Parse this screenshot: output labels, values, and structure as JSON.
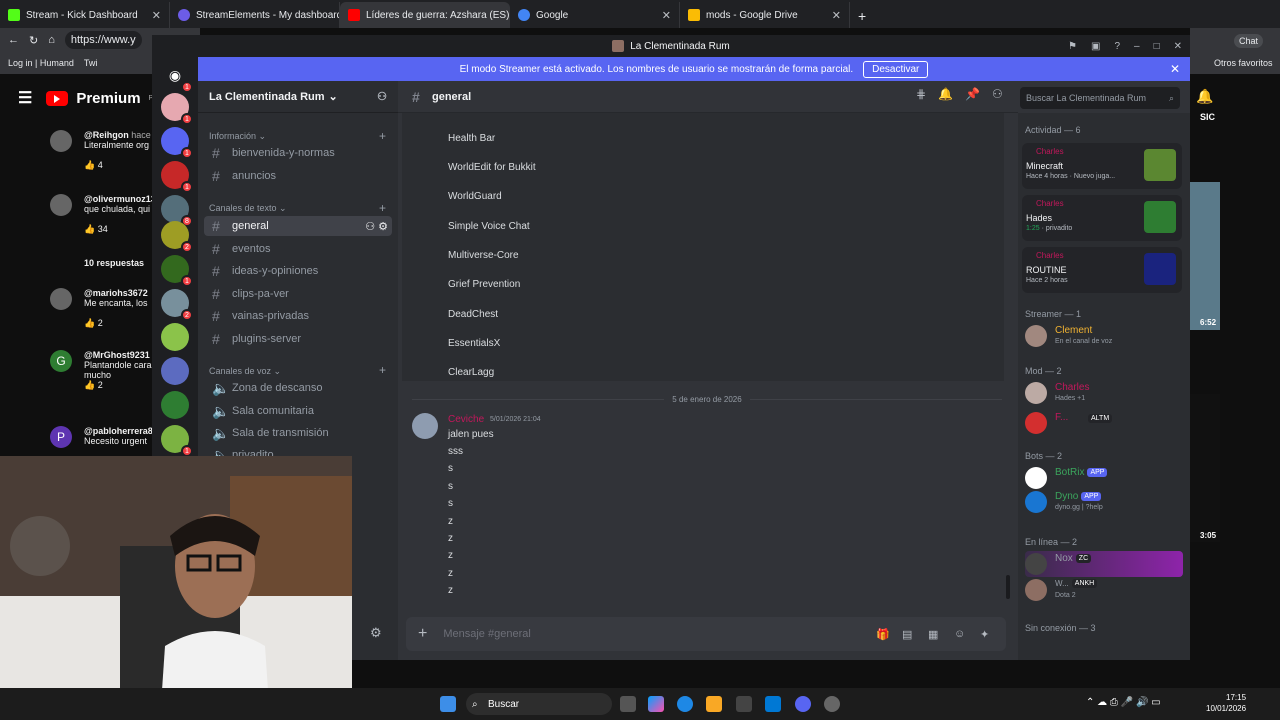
{
  "browser": {
    "tabs": [
      {
        "title": "Stream - Kick Dashboard",
        "color": "#53fc18"
      },
      {
        "title": "StreamElements - My dashboard",
        "color": "#6c5ce7"
      },
      {
        "title": "Líderes de guerra: Azshara (ES) - V",
        "color": "#ff0000"
      },
      {
        "title": "Google",
        "color": "#4285f4"
      },
      {
        "title": "mods - Google Drive",
        "color": "#fbbc04"
      }
    ],
    "url": "https://www.y",
    "bookmarks": [
      "Log in | Humand",
      "Twi"
    ],
    "other_bookmarks": "Otros favoritos",
    "chat_label": "Chat"
  },
  "youtube": {
    "logo": "Premium",
    "region": "PE",
    "comments": [
      {
        "user": "@Reihgon",
        "time": "hace 7",
        "text": "Literalmente org",
        "likes": "4"
      },
      {
        "user": "@olivermunoz13",
        "time": "",
        "text": "que chulada, qui",
        "likes": "34"
      },
      {
        "user": "@mariohs3672",
        "time": "h",
        "text": "Me encanta, los",
        "likes": "2"
      },
      {
        "user": "@MrGhost9231",
        "time": "h",
        "text": "Plantandole cara gustado mucho",
        "likes": "2"
      },
      {
        "user": "@pabloherrera86",
        "time": "",
        "text": "Necesito urgent",
        "likes": ""
      }
    ],
    "replies": "10 respuestas",
    "video_times": [
      "6:52",
      "3:05"
    ],
    "side_text": "SIC"
  },
  "discord": {
    "window_title": "La Clementinada Rum",
    "banner_text": "El modo Streamer está activado. Los nombres de usuario se mostrarán de forma parcial.",
    "banner_button": "Desactivar",
    "server_name": "La Clementinada Rum",
    "server_badges": [
      "1",
      "1",
      "1",
      "1",
      "8",
      "2",
      "1",
      "2",
      "1"
    ],
    "categories": {
      "info": "Información",
      "text": "Canales de texto",
      "voice": "Canales de voz"
    },
    "info_channels": [
      "bienvenida-y-normas",
      "anuncios"
    ],
    "text_channels": [
      "general",
      "eventos",
      "ideas-y-opiniones",
      "clips-pa-ver",
      "vainas-privadas",
      "plugins-server"
    ],
    "voice_channels": [
      "Zona de descanso",
      "Sala comunitaria",
      "Sala de transmisión",
      "privadito"
    ],
    "current_channel": "general",
    "search_placeholder": "Buscar La Clementinada Rum",
    "plugins": [
      "Health Bar",
      "WorldEdit for Bukkit",
      "WorldGuard",
      "Simple Voice Chat",
      "Multiverse-Core",
      "Grief Prevention",
      "DeadChest",
      "EssentialsX",
      "ClearLagg"
    ],
    "date_divider": "5 de enero de 2026",
    "message": {
      "author": "Ceviche",
      "timestamp": "5/01/2026 21:04",
      "lines": [
        "jalen pues",
        "sss",
        "s",
        "s",
        "s",
        "z",
        "z",
        "z",
        "z",
        "z"
      ]
    },
    "composer_placeholder": "Mensaje #general",
    "members": {
      "activity_header": "Actividad — 6",
      "activities": [
        {
          "user": "Charles",
          "game": "Minecraft",
          "status": "Hace 4 horas",
          "extra": "Nuevo juga...",
          "color": "#5b8731"
        },
        {
          "user": "Charles",
          "game": "Hades",
          "status": "1:25",
          "extra": "privadito",
          "color": "#2e7d32"
        },
        {
          "user": "Charles",
          "game": "ROUTINE",
          "status": "Hace 2 horas",
          "extra": "",
          "color": "#1a237e"
        }
      ],
      "groups": [
        {
          "header": "Streamer — 1",
          "items": [
            {
              "name": "Clement",
              "status": "En el canal de voz",
              "color": "#f0b232"
            }
          ]
        },
        {
          "header": "Mod — 2",
          "items": [
            {
              "name": "Charles",
              "status": "Hades +1",
              "color": "#c2185b"
            },
            {
              "name": "F...",
              "status": "",
              "tag": "ALTM",
              "color": "#c2185b"
            }
          ]
        },
        {
          "header": "Bots — 2",
          "items": [
            {
              "name": "BotRix",
              "status": "",
              "tag": "APP",
              "color": "#3ba55d"
            },
            {
              "name": "Dyno",
              "status": "dyno.gg | ?help",
              "tag": "APP",
              "color": "#3ba55d"
            }
          ]
        },
        {
          "header": "En línea — 2",
          "items": [
            {
              "name": "Nox",
              "status": "",
              "tag": "ZC",
              "color": "#949ba4"
            },
            {
              "name": "W...",
              "status": "Dota 2",
              "tag": "ANKH",
              "color": "#949ba4"
            }
          ]
        },
        {
          "header": "Sin conexión — 3",
          "items": []
        }
      ]
    }
  },
  "taskbar": {
    "search": "Buscar",
    "time": "17:15",
    "date": "10/01/2026"
  }
}
